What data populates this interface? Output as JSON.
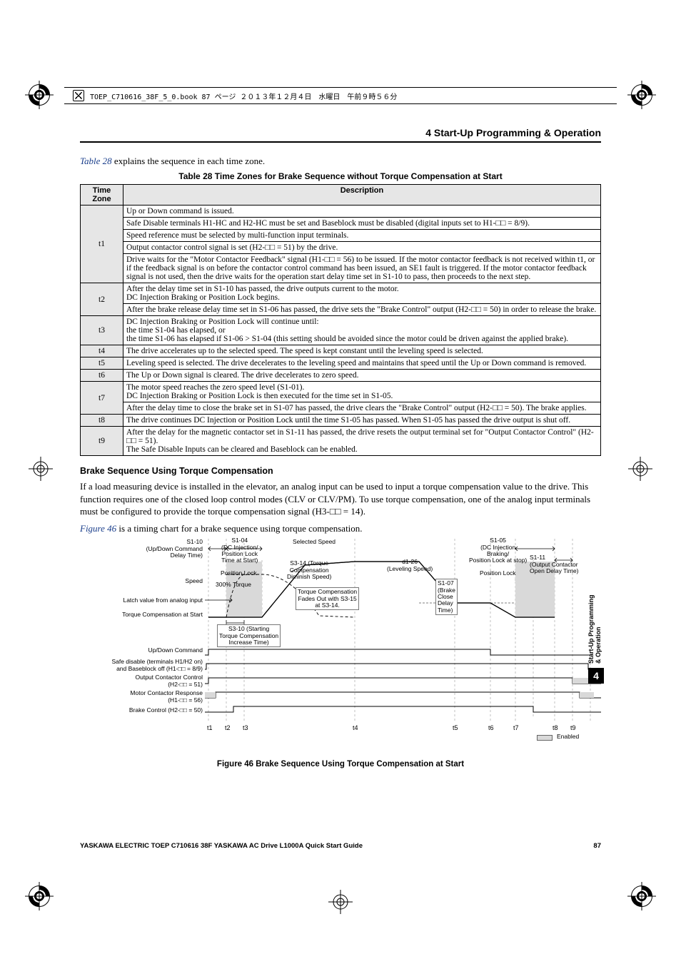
{
  "print_header": "TOEP_C710616_38F_5_0.book  87 ページ  ２０１３年１２月４日　水曜日　午前９時５６分",
  "section_header": "4  Start-Up Programming & Operation",
  "intro_link": "Table 28",
  "intro_rest": " explains the sequence in each time zone.",
  "table_title": "Table 28  Time Zones for Brake Sequence without Torque Compensation at Start",
  "th": {
    "tz": "Time Zone",
    "desc": "Description"
  },
  "rows": {
    "t1": {
      "label": "t1",
      "d0": "Up or Down command is issued.",
      "d1": "Safe Disable terminals H1-HC and H2-HC must be set and Baseblock must be disabled (digital inputs set to H1-□□ = 8/9).",
      "d2": "Speed reference must be selected by multi-function input terminals.",
      "d3": "Output contactor control signal is set (H2-□□ = 51) by the drive.",
      "d4": "Drive waits for the \"Motor Contactor Feedback\" signal (H1-□□ = 56) to be issued. If the motor contactor feedback is not received within t1, or if the feedback signal is on before the contactor control command has been issued, an SE1 fault is triggered. If the motor contactor feedback signal is not used, then the drive waits for the operation start delay time set in S1-10 to pass, then proceeds to the next step."
    },
    "t2": {
      "label": "t2",
      "d0": "After the delay time set in S1-10 has passed, the drive outputs current to the motor.\nDC Injection Braking or Position Lock begins.",
      "d1": "After the brake release delay time set in S1-06 has passed, the drive sets the \"Brake Control\" output (H2-□□ = 50) in order to release the brake."
    },
    "t3": {
      "label": "t3",
      "d0": "DC Injection Braking or Position Lock will continue until:\nthe time S1-04 has elapsed, or\nthe time S1-06 has elapsed if S1-06 > S1-04 (this setting should be avoided since the motor could be driven against the applied brake)."
    },
    "t4": {
      "label": "t4",
      "d0": "The drive accelerates up to the selected speed. The speed is kept constant until the leveling speed is selected."
    },
    "t5": {
      "label": "t5",
      "d0": "Leveling speed is selected. The drive decelerates to the leveling speed and maintains that speed until the Up or Down command is removed."
    },
    "t6": {
      "label": "t6",
      "d0": "The Up or Down signal is cleared. The drive decelerates to zero speed."
    },
    "t7": {
      "label": "t7",
      "d0": "The motor speed reaches the zero speed level (S1-01).\nDC Injection Braking or Position Lock is then executed for the time set in S1-05.",
      "d1": "After the delay time to close the brake set in S1-07 has passed, the drive clears the \"Brake Control\" output (H2-□□ = 50). The brake applies."
    },
    "t8": {
      "label": "t8",
      "d0": "The drive continues DC Injection or Position Lock until the time S1-05 has passed. When S1-05 has passed the drive output is shut off."
    },
    "t9": {
      "label": "t9",
      "d0": "After the delay for the magnetic contactor set in S1-11 has passed, the drive resets the output terminal set for \"Output Contactor Control\" (H2-□□ = 51).\nThe Safe Disable Inputs can be cleared and Baseblock can be enabled."
    }
  },
  "h4": "Brake Sequence Using Torque Compensation",
  "para1": "If a load measuring device is installed in the elevator, an analog input can be used to input a torque compensation value to the drive. This function requires one of the closed loop control modes (CLV or CLV/PM). To use torque compensation, one of the analog input terminals must be configured to provide the torque compensation signal (H3-□□ = 14).",
  "para2_link": "Figure 46",
  "para2_rest": " is a timing chart for a brake sequence using torque compensation.",
  "fig_caption": "Figure 46  Brake Sequence Using Torque Compensation at Start",
  "diagram": {
    "left_labels": {
      "s1_10": "S1-10\n(Up/Down Command\nDelay Time)",
      "speed": "Speed",
      "latch": "Latch value from analog input",
      "tcomp_start": "Torque Compensation at Start",
      "up_down": "Up/Down Command",
      "safe_disable": "Safe disable (terminals H1/H2 on)\nand Baseblock off (H1-□□ = 8/9)",
      "out_contactor": "Output Contactor Control\n(H2-□□ = 51)",
      "motor_resp": "Motor Contactor Response\n(H1-□□ = 56)",
      "brake_ctrl": "Brake Control (H2-□□ = 50)"
    },
    "notes": {
      "s1_04": "S1-04\n(DC Injection/\nPosition Lock\nTime at Start)",
      "pos_lock_left": "Position Lock",
      "pct300": "300% Torque",
      "s3_10": "S3-10 (Starting\nTorque Compensation\nIncrease Time)",
      "sel_speed": "Selected Speed",
      "s3_14": "S3-14 (Torque\nCompensation\nDiminish Speed)",
      "tcomp_fade": "Torque Compensation\nFades Out with S3-15\nat S3-14.",
      "d1_26": "d1-26\n(Leveling Speed)",
      "s1_05": "S1-05\n(DC Injection\nBraking/\nPosition Lock at stop)",
      "pos_lock_right": "Position Lock",
      "s1_07": "S1-07\n(Brake\nClose\nDelay\nTime)",
      "s1_11": "S1-11\n(Output Contactor\nOpen Delay Time)",
      "enabled": "Enabled"
    },
    "ticks": [
      "t1",
      "t2",
      "t3",
      "t4",
      "t5",
      "t6",
      "t7",
      "t8",
      "t9"
    ]
  },
  "footer_left": "YASKAWA ELECTRIC TOEP C710616 38F YASKAWA AC Drive L1000A Quick Start Guide",
  "footer_right": "87",
  "side_tab_label": "Start-Up Programming\n& Operation",
  "side_tab_num": "4",
  "chart_data": {
    "type": "line",
    "title": "Brake Sequence Using Torque Compensation at Start (timing chart)",
    "x": [
      "t1",
      "t2",
      "t3",
      "t4",
      "t5",
      "t6",
      "t7",
      "t8",
      "t9"
    ],
    "series": [
      {
        "name": "Speed (%)",
        "values": [
          0,
          0,
          0,
          100,
          100,
          25,
          0,
          0,
          0
        ],
        "note": "Selected Speed at t4; decel to d1-26 Leveling Speed during t5; decel to zero at t6"
      },
      {
        "name": "Torque Compensation at Start (%)",
        "values": [
          0,
          300,
          300,
          0,
          0,
          0,
          0,
          0,
          0
        ],
        "note": "Ramp up over S3-10 to 300%; fades with S3-15 at S3-14"
      },
      {
        "name": "Up/Down Command",
        "values": [
          1,
          1,
          1,
          1,
          1,
          1,
          0,
          0,
          0
        ]
      },
      {
        "name": "Safe disable H1/H2 on & Baseblock off (H1-□□=8/9)",
        "values": [
          1,
          1,
          1,
          1,
          1,
          1,
          1,
          1,
          1
        ]
      },
      {
        "name": "Output Contactor Control (H2-□□=51)",
        "values": [
          1,
          1,
          1,
          1,
          1,
          1,
          1,
          1,
          1
        ]
      },
      {
        "name": "Motor Contactor Response (H1-□□=56)",
        "values": [
          1,
          1,
          1,
          1,
          1,
          1,
          1,
          1,
          1
        ]
      },
      {
        "name": "Brake Control (H2-□□=50)",
        "values": [
          0,
          1,
          1,
          1,
          1,
          1,
          1,
          0,
          0
        ]
      }
    ],
    "annotations": [
      "S1-10 (Up/Down Command Delay Time) spans t1",
      "S1-04 (DC Injection/Position Lock Time at Start) spans t2–t3",
      "S1-05 (DC Injection Braking/Position Lock at stop) spans t7–t8",
      "S1-07 (Brake Close Delay Time) spans t7",
      "S1-11 (Output Contactor Open Delay Time) spans t9",
      "d1-26 (Leveling Speed) is the plateau during t5–t6"
    ]
  }
}
